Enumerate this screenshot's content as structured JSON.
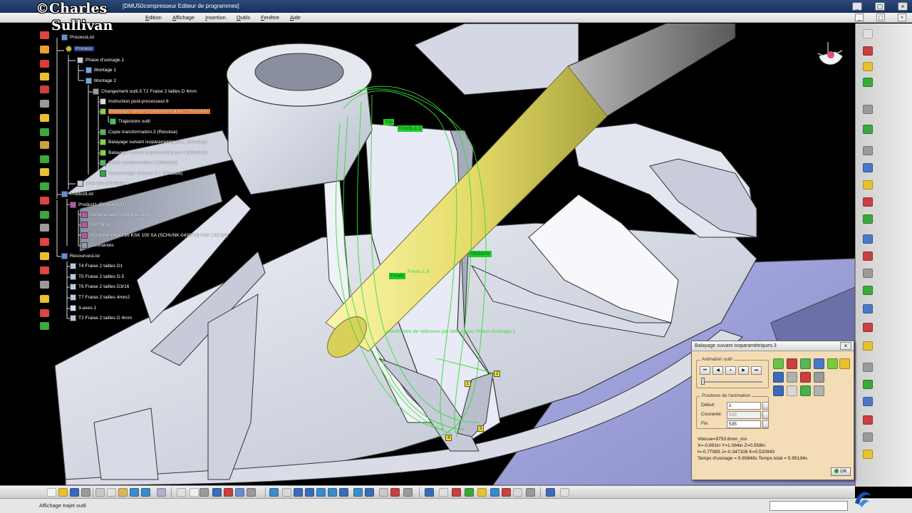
{
  "window": {
    "title": "[DMU50compresseur Editeur de programmes]",
    "menu": [
      "Edition",
      "Affichage",
      "Insertion",
      "Outils",
      "Fenêtre",
      "Aide"
    ],
    "buttons": {
      "minimize": "_",
      "restore": "▢",
      "close": "×"
    },
    "mdi_buttons": {
      "minimize": "_",
      "restore": "▢",
      "close": "×"
    }
  },
  "watermark": {
    "line1": "©Charles",
    "line2": "Sullivan"
  },
  "tree": {
    "processlist": "ProcessList",
    "process": "Process",
    "phase": "Phase d'usinage.1",
    "montage1": "Montage 1",
    "montage2": "Montage 2",
    "changement": "Changement outil.5  T2 Fraise 2 tailles D 4mm",
    "instruction": "Instruction post-processeur.6",
    "balayage3": "Balayage suivant isoparamétriques.3 (Résolue)",
    "trajectoire": "Trajectoire outil",
    "copie3": "Copie transformation.3 (Résolue)",
    "balayage1": "Balayage suivant isoparamétriques.1 (Résolue)",
    "balayage4": "Balayage suivant isoparamétriques.4 (Résolue)",
    "copie4": "Copie transformation.4 (Résolue)",
    "contournage": "Contournage niveaux Z.1 (Résolue)",
    "liste": "Liste des procédés.1",
    "productlist": "ProductList",
    "product1": "Product1 (Product1.1)",
    "compresseur": "Compresseur (Compresseur)",
    "brut": "brut (brut)",
    "schunk": "SCHUNK-0430716 KSK 100 SA  (SCHUNK-0430716 KSK 100 SA)",
    "contraintes": "Contraintes",
    "resourceslist": "ResourcesList",
    "t4": "T4 Fraise 2 tailles D1",
    "t5": "T5 Fraise 2 tailles D.5",
    "t6": "T6 Fraise 2 tailles D3/16",
    "t7": "T7 Fraise 2 tailles 4mm2",
    "axes": "3-axes.1",
    "t2": "T2 Fraise 2 tailles D 4mm"
  },
  "viewport_labels": {
    "top": "Top",
    "fonds11": "Fonds.1.1",
    "obstacle": "Obstacle",
    "fonds": "Fonds",
    "fonds16": "Fonds.1.6",
    "repere": "Axe/Repère de référence par défaut pour Phase d'usinage.1",
    "pt1": "1",
    "pt2": "2",
    "pt3": "3",
    "pt4": "4"
  },
  "dialog": {
    "title": "Balayage suivant isoparamétriques.3",
    "close": "×",
    "animation_group": "Animation outil",
    "player": {
      "first": "⏮",
      "prev": "◀",
      "pause": "⏸",
      "next": "▶",
      "last": "⏭"
    },
    "positions_group": "Positions de l'animation",
    "debut_label": "Début",
    "debut_value": "1",
    "courante_label": "Courante",
    "courante_value": "535",
    "fin_label": "Fin",
    "fin_value": "535",
    "vitesse": "Vitesse=9753.6mm_mn",
    "xyz": "X=-0.891in Y=1.084in Z=0.558in",
    "ijk": "I=-0.77983 J=-0.347108 K=0.520943",
    "temps": "Temps d'usinage = 5.65848s    Temps total = 5.95134s",
    "ok": "OK"
  },
  "status": {
    "text": "Affichage trajet outil"
  },
  "colors": {
    "background": "#000000",
    "part": "#c8cdd9",
    "tool": "#e6e077",
    "path": "#33dd33",
    "dialog": "#f3dcb6",
    "highlight": "#f07820"
  },
  "icons": {
    "compass": "compass-icon",
    "catia_logo": "catia-logo-icon",
    "tree_process": "process-icon",
    "tree_tool": "tool-icon",
    "tree_product": "product-icon"
  }
}
